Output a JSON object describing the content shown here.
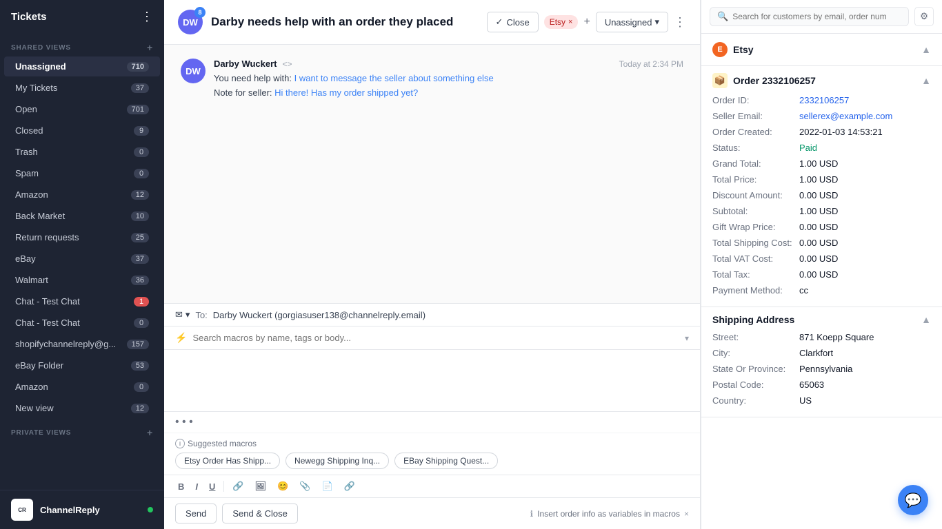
{
  "sidebar": {
    "title": "Tickets",
    "shared_views_label": "SHARED VIEWS",
    "private_views_label": "PRIVATE VIEWS",
    "items": [
      {
        "id": "unassigned",
        "label": "Unassigned",
        "count": "710",
        "active": true
      },
      {
        "id": "my-tickets",
        "label": "My Tickets",
        "count": "37",
        "active": false
      },
      {
        "id": "open",
        "label": "Open",
        "count": "701",
        "active": false
      },
      {
        "id": "closed",
        "label": "Closed",
        "count": "9",
        "active": false
      },
      {
        "id": "trash",
        "label": "Trash",
        "count": "0",
        "active": false
      },
      {
        "id": "spam",
        "label": "Spam",
        "count": "0",
        "active": false
      },
      {
        "id": "amazon",
        "label": "Amazon",
        "count": "12",
        "active": false
      },
      {
        "id": "back-market",
        "label": "Back Market",
        "count": "10",
        "active": false
      },
      {
        "id": "return-requests",
        "label": "Return requests",
        "count": "25",
        "active": false
      },
      {
        "id": "ebay",
        "label": "eBay",
        "count": "37",
        "active": false
      },
      {
        "id": "walmart",
        "label": "Walmart",
        "count": "36",
        "active": false
      },
      {
        "id": "chat-test-chat-1",
        "label": "Chat - Test Chat",
        "count": "1",
        "badge_red": true,
        "active": false
      },
      {
        "id": "chat-test-chat-2",
        "label": "Chat - Test Chat",
        "count": "0",
        "active": false
      },
      {
        "id": "shopify",
        "label": "shopifychannelreply@g...",
        "count": "157",
        "active": false
      },
      {
        "id": "ebay-folder",
        "label": "eBay Folder",
        "count": "53",
        "active": false
      },
      {
        "id": "amazon-2",
        "label": "Amazon",
        "count": "0",
        "active": false
      },
      {
        "id": "new-view",
        "label": "New view",
        "count": "12",
        "active": false
      }
    ],
    "footer": {
      "brand": "ChannelReply"
    }
  },
  "ticket": {
    "avatar_initials": "DW",
    "notification_count": "8",
    "title": "Darby needs help with an order they placed",
    "close_btn": "Close",
    "tag": "Etsy",
    "assign_label": "Unassigned",
    "message": {
      "sender": "Darby Wuckert",
      "time": "Today at 2:34 PM",
      "body_prefix": "You need help with:",
      "body_highlight": "I want to message the seller about something else",
      "body_note_prefix": "Note for seller:",
      "body_note_highlight": "Hi there! Has my order shipped yet?"
    }
  },
  "reply": {
    "to_label": "To:",
    "to_address": "Darby Wuckert (gorgiasuser138@channelreply.email)",
    "macros_placeholder": "Search macros by name, tags or body...",
    "suggested_label": "Suggested macros",
    "suggested_pills": [
      "Etsy Order Has Shipp...",
      "Newegg Shipping Inq...",
      "EBay Shipping Quest..."
    ],
    "send_btn": "Send",
    "send_close_btn": "Send & Close",
    "insert_info": "Insert order info as variables in macros"
  },
  "right_panel": {
    "search_placeholder": "Search for customers by email, order num",
    "etsy_section": {
      "title": "Etsy"
    },
    "order_section": {
      "title": "Order 2332106257",
      "fields": [
        {
          "label": "Order ID:",
          "value": "2332106257",
          "type": "blue"
        },
        {
          "label": "Seller Email:",
          "value": "sellerex@example.com",
          "type": "blue"
        },
        {
          "label": "Order Created:",
          "value": "2022-01-03 14:53:21",
          "type": "normal"
        },
        {
          "label": "Status:",
          "value": "Paid",
          "type": "green"
        },
        {
          "label": "Grand Total:",
          "value": "1.00 USD",
          "type": "normal"
        },
        {
          "label": "Total Price:",
          "value": "1.00 USD",
          "type": "normal"
        },
        {
          "label": "Discount Amount:",
          "value": "0.00 USD",
          "type": "normal"
        },
        {
          "label": "Subtotal:",
          "value": "1.00 USD",
          "type": "normal"
        },
        {
          "label": "Gift Wrap Price:",
          "value": "0.00 USD",
          "type": "normal"
        },
        {
          "label": "Total Shipping Cost:",
          "value": "0.00 USD",
          "type": "normal"
        },
        {
          "label": "Total VAT Cost:",
          "value": "0.00 USD",
          "type": "normal"
        },
        {
          "label": "Total Tax:",
          "value": "0.00 USD",
          "type": "normal"
        },
        {
          "label": "Payment Method:",
          "value": "cc",
          "type": "normal"
        }
      ]
    },
    "shipping_section": {
      "title": "Shipping Address",
      "fields": [
        {
          "label": "Street:",
          "value": "871 Koepp Square",
          "type": "normal"
        },
        {
          "label": "City:",
          "value": "Clarkfort",
          "type": "normal"
        },
        {
          "label": "State Or Province:",
          "value": "Pennsylvania",
          "type": "normal"
        },
        {
          "label": "Postal Code:",
          "value": "65063",
          "type": "normal"
        },
        {
          "label": "Country:",
          "value": "US",
          "type": "normal"
        }
      ]
    }
  }
}
